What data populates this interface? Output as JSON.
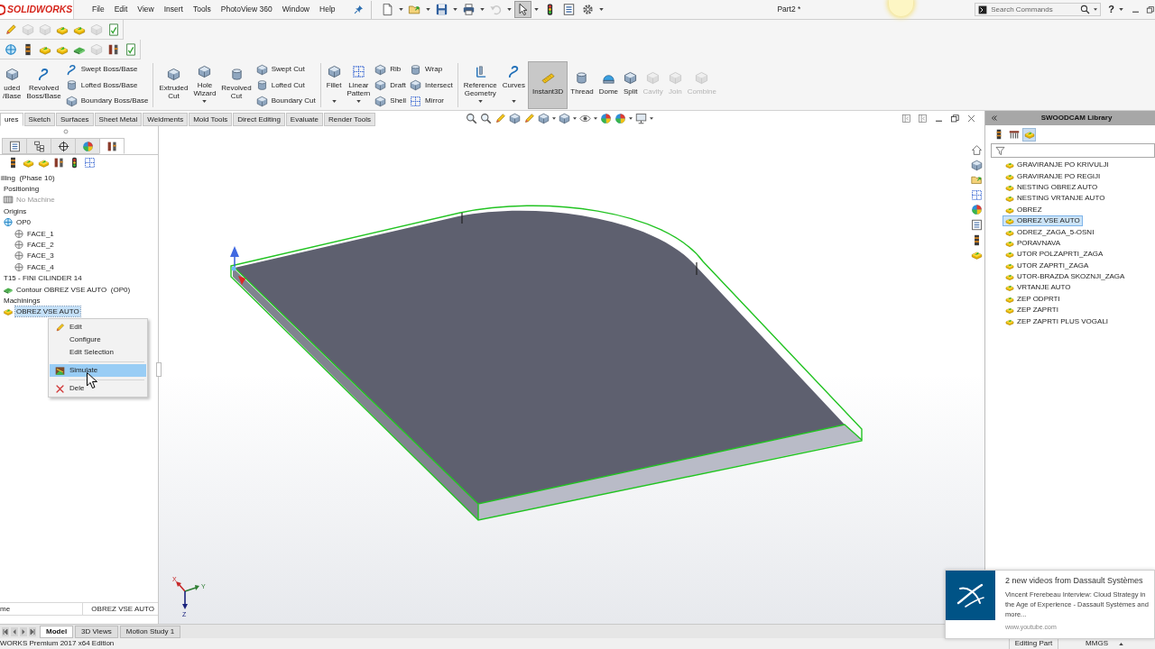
{
  "title_bar": {
    "logo": "SOLIDWORKS",
    "menu": [
      "File",
      "Edit",
      "View",
      "Insert",
      "Tools",
      "PhotoView 360",
      "Window",
      "Help"
    ],
    "quick_access": [
      {
        "dropdown": true,
        "disabled": false,
        "pressed": false
      },
      {
        "dropdown": true,
        "disabled": false,
        "pressed": false
      },
      {
        "dropdown": true,
        "disabled": false,
        "pressed": false
      },
      {
        "dropdown": true,
        "disabled": false,
        "pressed": false
      },
      {
        "dropdown": true,
        "disabled": true,
        "pressed": false
      },
      {
        "dropdown": true,
        "disabled": false,
        "pressed": true
      },
      {
        "dropdown": false,
        "disabled": false,
        "pressed": false
      },
      {
        "dropdown": false,
        "disabled": false,
        "pressed": false
      },
      {
        "dropdown": true,
        "disabled": false,
        "pressed": false
      }
    ],
    "document_title": "Part2 *",
    "search": {
      "placeholder": "Search Commands"
    },
    "help": "?"
  },
  "toolbars": [
    [
      {
        "disabled": false
      },
      {
        "disabled": true
      },
      {
        "disabled": true
      },
      {
        "disabled": false
      },
      {
        "disabled": false
      },
      {
        "disabled": true
      },
      {
        "disabled": false
      }
    ],
    [
      {
        "disabled": false
      },
      {
        "disabled": false
      },
      {
        "disabled": false
      },
      {
        "disabled": false
      },
      {
        "disabled": false
      },
      {
        "disabled": true
      },
      {
        "disabled": false
      },
      {
        "disabled": false
      }
    ]
  ],
  "ribbon": [
    {
      "kind": "large",
      "label": "uded /Base",
      "dropdown": false,
      "pressed": false,
      "disabled": false
    },
    {
      "kind": "large",
      "label": "Revolved Boss/Base",
      "dropdown": false,
      "pressed": false,
      "disabled": false
    },
    {
      "kind": "stack",
      "items": [
        {
          "label": "Swept Boss/Base",
          "disabled": false
        },
        {
          "label": "Lofted Boss/Base",
          "disabled": false
        },
        {
          "label": "Boundary Boss/Base",
          "disabled": false
        }
      ]
    },
    {
      "kind": "separator"
    },
    {
      "kind": "large",
      "label": "Extruded Cut",
      "dropdown": false,
      "pressed": false,
      "disabled": false
    },
    {
      "kind": "large",
      "label": "Hole Wizard",
      "dropdown": true,
      "pressed": false,
      "disabled": false
    },
    {
      "kind": "large",
      "label": "Revolved Cut",
      "dropdown": false,
      "pressed": false,
      "disabled": false
    },
    {
      "kind": "stack",
      "items": [
        {
          "label": "Swept Cut",
          "disabled": false
        },
        {
          "label": "Lofted Cut",
          "disabled": false
        },
        {
          "label": "Boundary Cut",
          "disabled": false
        }
      ]
    },
    {
      "kind": "separator"
    },
    {
      "kind": "large",
      "label": "Fillet",
      "dropdown": true,
      "pressed": false,
      "disabled": false
    },
    {
      "kind": "large",
      "label": "Linear Pattern",
      "dropdown": true,
      "pressed": false,
      "disabled": false
    },
    {
      "kind": "stack",
      "items": [
        {
          "label": "Rib",
          "disabled": false
        },
        {
          "label": "Draft",
          "disabled": false
        },
        {
          "label": "Shell",
          "disabled": false
        }
      ]
    },
    {
      "kind": "stack",
      "items": [
        {
          "label": "Wrap",
          "disabled": false
        },
        {
          "label": "Intersect",
          "disabled": false
        },
        {
          "label": "Mirror",
          "disabled": false
        }
      ]
    },
    {
      "kind": "separator"
    },
    {
      "kind": "large",
      "label": "Reference Geometry",
      "dropdown": true,
      "pressed": false,
      "disabled": false
    },
    {
      "kind": "large",
      "label": "Curves",
      "dropdown": true,
      "pressed": false,
      "disabled": false
    },
    {
      "kind": "large",
      "label": "Instant3D",
      "dropdown": false,
      "pressed": true,
      "disabled": false
    },
    {
      "kind": "large",
      "label": "Thread",
      "dropdown": false,
      "pressed": false,
      "disabled": false
    },
    {
      "kind": "large",
      "label": "Dome",
      "dropdown": false,
      "pressed": false,
      "disabled": false
    },
    {
      "kind": "large",
      "label": "Split",
      "dropdown": false,
      "pressed": false,
      "disabled": false
    },
    {
      "kind": "large",
      "label": "Cavity",
      "dropdown": false,
      "pressed": false,
      "disabled": true
    },
    {
      "kind": "large",
      "label": "Join",
      "dropdown": false,
      "pressed": false,
      "disabled": true
    },
    {
      "kind": "large",
      "label": "Combine",
      "dropdown": false,
      "pressed": false,
      "disabled": true
    }
  ],
  "command_tabs": [
    {
      "label": "ures",
      "selected": true
    },
    {
      "label": "Sketch",
      "selected": false
    },
    {
      "label": "Surfaces",
      "selected": false
    },
    {
      "label": "Sheet Metal",
      "selected": false
    },
    {
      "label": "Weldments",
      "selected": false
    },
    {
      "label": "Mold Tools",
      "selected": false
    },
    {
      "label": "Direct Editing",
      "selected": false
    },
    {
      "label": "Evaluate",
      "selected": false
    },
    {
      "label": "Render Tools",
      "selected": false
    }
  ],
  "feature_manager": {
    "tabs": [
      {
        "selected": false
      },
      {
        "selected": false
      },
      {
        "selected": false
      },
      {
        "selected": false
      },
      {
        "selected": true
      }
    ],
    "tree": [
      {
        "label": "illing  (Phase 10)",
        "kind": "plain",
        "selected": false,
        "disabled": false,
        "children": [
          {
            "label": "Positioning",
            "kind": "plain",
            "selected": false,
            "disabled": false
          },
          {
            "label": "No Machine",
            "kind": "machine",
            "selected": false,
            "disabled": true
          },
          {
            "label": "Origins",
            "kind": "plain",
            "selected": false,
            "disabled": false
          },
          {
            "label": "OP0",
            "kind": "origin",
            "selected": false,
            "disabled": false,
            "children": [
              {
                "label": "FACE_1",
                "kind": "face",
                "selected": false,
                "disabled": false
              },
              {
                "label": "FACE_2",
                "kind": "face",
                "selected": false,
                "disabled": false
              },
              {
                "label": "FACE_3",
                "kind": "face",
                "selected": false,
                "disabled": false
              },
              {
                "label": "FACE_4",
                "kind": "face",
                "selected": false,
                "disabled": false
              }
            ]
          },
          {
            "label": "T15 - FINI CILINDER 14",
            "kind": "plain",
            "selected": false,
            "disabled": false
          },
          {
            "label": "Contour OBREZ VSE AUTO  (OP0)",
            "kind": "contour",
            "selected": false,
            "disabled": false
          },
          {
            "label": "Machinings",
            "kind": "plain",
            "selected": false,
            "disabled": false
          },
          {
            "label": "OBREZ VSE AUTO",
            "kind": "machining",
            "selected": true,
            "disabled": false
          }
        ]
      }
    ],
    "property": {
      "name": "me",
      "value": "OBREZ VSE AUTO"
    }
  },
  "context_menu": [
    {
      "kind": "pencil",
      "label": "Edit",
      "selected": false
    },
    {
      "kind": "plain",
      "label": "Configure",
      "selected": false
    },
    {
      "kind": "plain",
      "label": "Edit Selection",
      "selected": false
    },
    {
      "kind": "separator"
    },
    {
      "kind": "simulate",
      "label": "Simulate",
      "selected": true
    },
    {
      "kind": "separator"
    },
    {
      "kind": "cross",
      "label": "Dele",
      "selected": false
    }
  ],
  "viewport": {
    "triad": [
      "X",
      "Y",
      "Z"
    ]
  },
  "task_pane": {
    "title": "SWOODCAM Library",
    "tabs": [
      {
        "selected": false
      },
      {
        "selected": false
      },
      {
        "selected": true
      }
    ],
    "items": [
      {
        "label": "GRAVIRANJE PO KRIVULJI",
        "selected": false
      },
      {
        "label": "GRAVIRANJE PO REGIJI",
        "selected": false
      },
      {
        "label": "NESTING OBREZ AUTO",
        "selected": false
      },
      {
        "label": "NESTING VRTANJE AUTO",
        "selected": false
      },
      {
        "label": "OBREZ",
        "selected": false
      },
      {
        "label": "OBREZ VSE AUTO",
        "selected": true
      },
      {
        "label": "ODREZ_ZAGA_5-OSNI",
        "selected": false
      },
      {
        "label": "PORAVNAVA",
        "selected": false
      },
      {
        "label": "UTOR POLZAPRTI_ZAGA",
        "selected": false
      },
      {
        "label": "UTOR ZAPRTI_ZAGA",
        "selected": false
      },
      {
        "label": "UTOR-BRAZDA SKOZNJI_ZAGA",
        "selected": false
      },
      {
        "label": "VRTANJE AUTO",
        "selected": false
      },
      {
        "label": "ZEP ODPRTI",
        "selected": false
      },
      {
        "label": "ZEP ZAPRTI",
        "selected": false
      },
      {
        "label": "ZEP ZAPRTI PLUS VOGALI",
        "selected": false
      }
    ]
  },
  "notification": {
    "title": "2 new videos from Dassault Systèmes",
    "body": "Vincent Frerebeau Interview: Cloud Strategy in the Age of Experience - Dassault Systèmes and more...",
    "source": "www.youtube.com"
  },
  "bottom_tabs": [
    {
      "label": "Model",
      "selected": true
    },
    {
      "label": "3D Views",
      "selected": false
    },
    {
      "label": "Motion Study 1",
      "selected": false
    }
  ],
  "status_bar": {
    "product": "WORKS Premium 2017 x64 Edition",
    "mode": "Editing Part",
    "units": "MMGS"
  }
}
